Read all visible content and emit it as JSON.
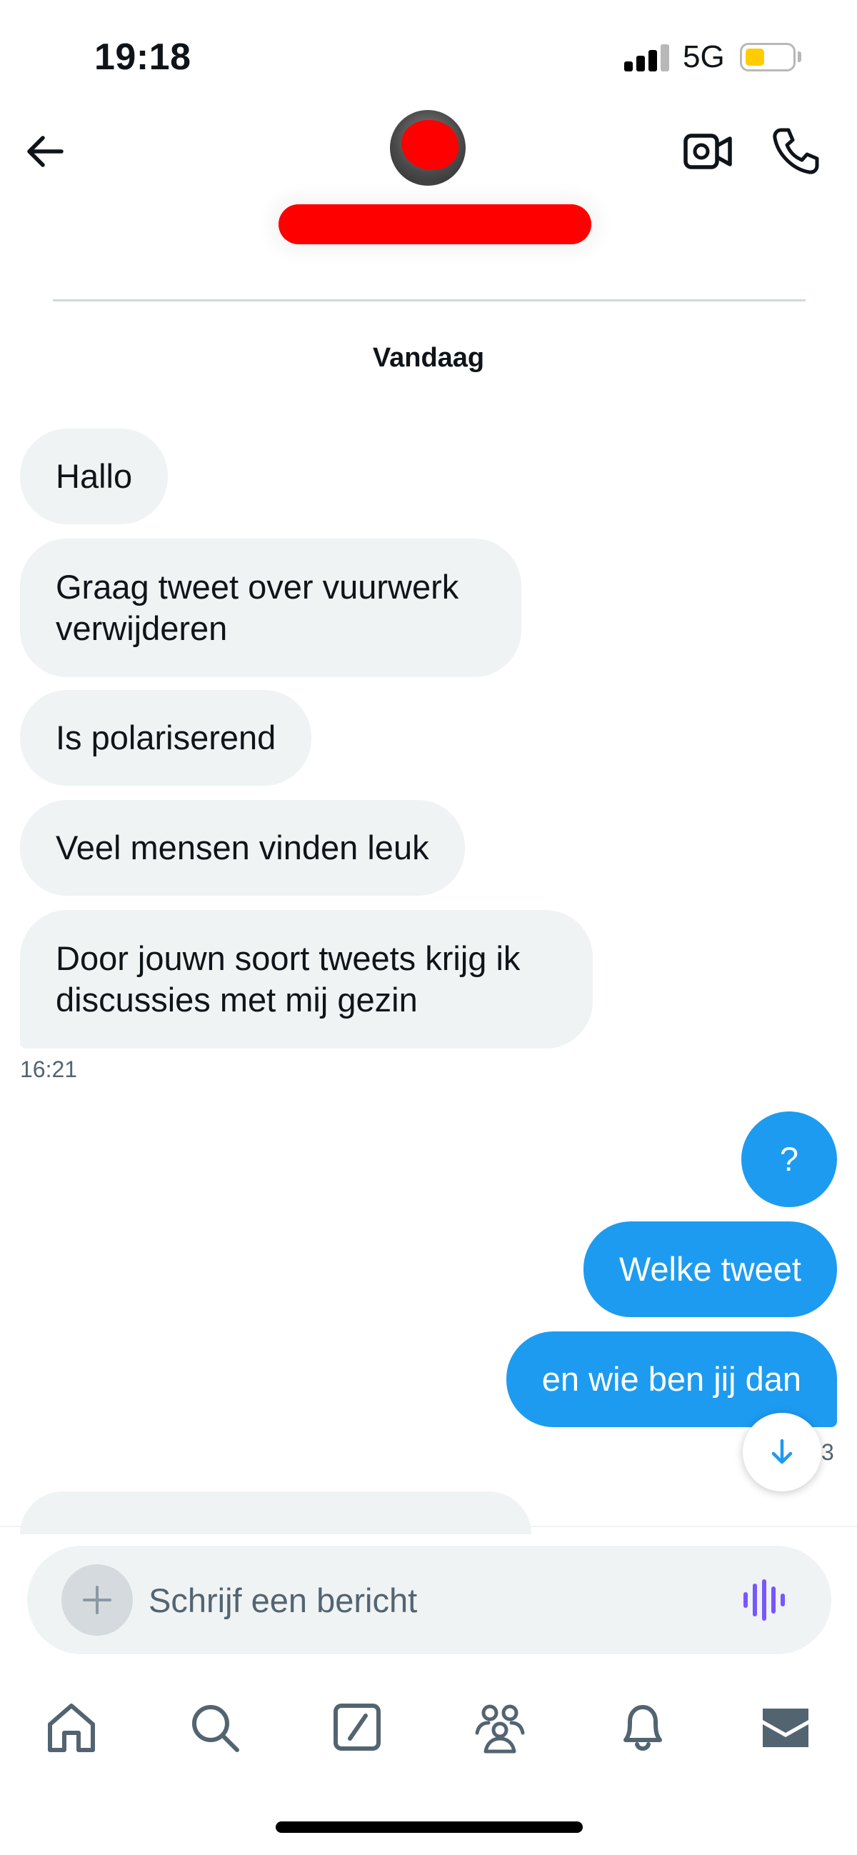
{
  "status_bar": {
    "time": "19:18",
    "network": "5G",
    "battery_level": 0.4,
    "battery_color": "#ffcc00"
  },
  "header": {
    "back_icon": "arrow-left-icon",
    "video_icon": "video-camera-icon",
    "call_icon": "phone-icon"
  },
  "conversation": {
    "date_label": "Vandaag",
    "incoming": [
      {
        "text": "Hallo"
      },
      {
        "line1": "Graag tweet over vuurwerk",
        "line2": "verwijderen"
      },
      {
        "text": "Is polariserend"
      },
      {
        "text": "Veel mensen vinden leuk"
      },
      {
        "line1": "Door jouwn soort tweets krijg ik",
        "line2": "discussies met mij gezin"
      }
    ],
    "incoming_time": "16:21",
    "outgoing": [
      {
        "text": "?"
      },
      {
        "text": "Welke tweet"
      },
      {
        "text": "en wie ben jij dan"
      }
    ],
    "outgoing_time_fragment": "3"
  },
  "composer": {
    "placeholder": "Schrijf een bericht",
    "voice_color": "#7856ff"
  },
  "bottom_nav": [
    {
      "icon": "home-icon"
    },
    {
      "icon": "search-icon"
    },
    {
      "icon": "compose-icon"
    },
    {
      "icon": "communities-icon"
    },
    {
      "icon": "bell-icon"
    },
    {
      "icon": "mail-icon"
    }
  ],
  "colors": {
    "accent": "#1d9bf0",
    "incoming_bubble": "#eff3f4",
    "redaction": "#ff0000"
  }
}
